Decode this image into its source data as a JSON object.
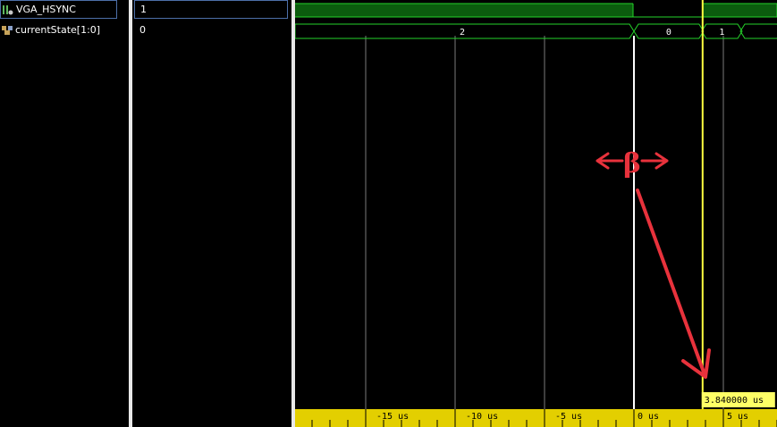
{
  "signals": [
    {
      "name": "VGA_HSYNC",
      "value": "1",
      "icon": "logic-bit-icon"
    },
    {
      "name": "currentState[1:0]",
      "value": "0",
      "icon": "bus-icon"
    }
  ],
  "timeline": {
    "ticks": [
      {
        "label": "-15 us",
        "t": -15
      },
      {
        "label": "-10 us",
        "t": -10
      },
      {
        "label": "-5 us",
        "t": -5
      },
      {
        "label": "0 us",
        "t": 0
      },
      {
        "label": "5 us",
        "t": 5
      }
    ],
    "cursor_time_us": 3.84,
    "cursor_label": "3.840000 us",
    "range_us": [
      -18.95,
      8.0
    ]
  },
  "bus_segments": [
    {
      "value": "2",
      "start": -18.95,
      "end": -0.25
    },
    {
      "value": "0",
      "start": 0.25,
      "end": 3.64
    },
    {
      "value": "1",
      "start": 4.04,
      "end": 5.8
    },
    {
      "value": "",
      "start": 6.2,
      "end": 8.0
    }
  ],
  "hsync_high_periods": [
    {
      "start": -18.95,
      "end": -0.05
    },
    {
      "start": 3.84,
      "end": 8.0
    }
  ],
  "annotation": {
    "text": "β",
    "color": "#e8323c"
  },
  "colors": {
    "wave_green": "#25d22a",
    "wave_fill": "#0b5c0e",
    "cursor": "#ffff40",
    "ruler": "#e3cf00",
    "grid": "#7a7a7a"
  }
}
